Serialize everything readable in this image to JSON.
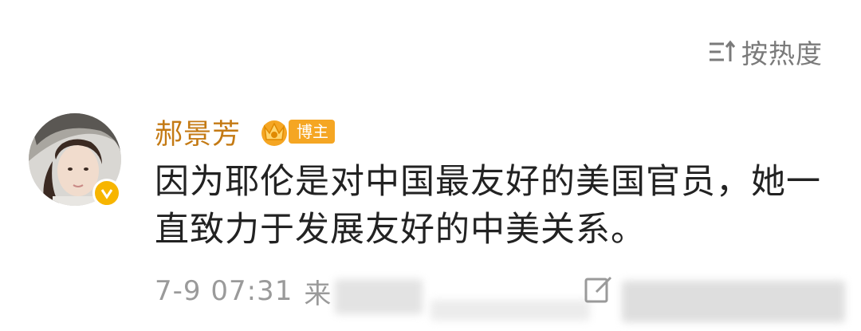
{
  "sort": {
    "icon": "sort-lines-icon",
    "label": "按热度"
  },
  "comment": {
    "avatar": "user-avatar",
    "verified_icon": "verified-v-icon",
    "username": "郝景芳",
    "badge": {
      "icon": "crown-icon",
      "label": "博主"
    },
    "text": "因为耶伦是对中国最友好的美国官员，她一直致力于发展友好的中美关系。",
    "time": "7-9 07:31",
    "source_partial": "来",
    "edit_icon": "edit-icon"
  },
  "colors": {
    "username": "#c47a14",
    "badge": "#f5a623",
    "verified": "#f7b500",
    "meta_text": "#9a9a9a",
    "body_text": "#222222"
  }
}
